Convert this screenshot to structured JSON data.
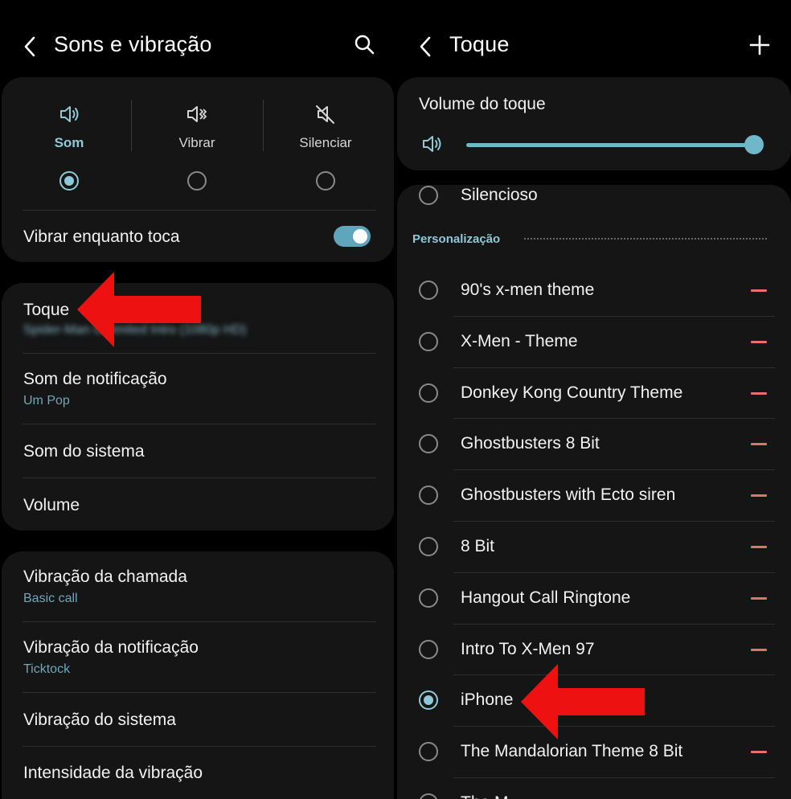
{
  "left": {
    "title": "Sons e vibração",
    "modes": [
      {
        "label": "Som",
        "icon": "speaker-icon",
        "selected": true
      },
      {
        "label": "Vibrar",
        "icon": "vibrate-icon",
        "selected": false
      },
      {
        "label": "Silenciar",
        "icon": "mute-icon",
        "selected": false
      }
    ],
    "vibrate_while_ringing": {
      "label": "Vibrar enquanto toca",
      "on": true
    },
    "settings": [
      {
        "label": "Toque",
        "value": "Spider-Man Unlimited Intro (1080p HD)"
      },
      {
        "label": "Som de notificação",
        "value": "Um Pop"
      },
      {
        "label": "Som do sistema"
      },
      {
        "label": "Volume"
      }
    ],
    "vibration_settings": [
      {
        "label": "Vibração da chamada",
        "value": "Basic call"
      },
      {
        "label": "Vibração da notificação",
        "value": "Ticktock"
      },
      {
        "label": "Vibração do sistema"
      },
      {
        "label": "Intensidade da vibração"
      }
    ]
  },
  "right": {
    "title": "Toque",
    "volume_label": "Volume do toque",
    "volume_level": 1.0,
    "silent_option": "Silencioso",
    "section_label": "Personalização",
    "ringtones": [
      {
        "name": "90's x-men theme",
        "selected": false,
        "removable": true
      },
      {
        "name": "X-Men - Theme",
        "selected": false,
        "removable": true
      },
      {
        "name": "Donkey Kong Country Theme",
        "selected": false,
        "removable": true
      },
      {
        "name": "Ghostbusters 8 Bit",
        "selected": false,
        "removable": true
      },
      {
        "name": "Ghostbusters with Ecto siren",
        "selected": false,
        "removable": true
      },
      {
        "name": "8 Bit",
        "selected": false,
        "removable": true
      },
      {
        "name": "Hangout Call Ringtone",
        "selected": false,
        "removable": true
      },
      {
        "name": "Intro To X-Men 97",
        "selected": false,
        "removable": true
      },
      {
        "name": "iPhone",
        "selected": true,
        "removable": false
      },
      {
        "name": "The Mandalorian Theme 8 Bit",
        "selected": false,
        "removable": true
      },
      {
        "name": "The M",
        "selected": false,
        "removable": false
      }
    ]
  },
  "colors": {
    "accent": "#8fc9d8",
    "subtext": "#6fa7b8",
    "remove": "#e0716b",
    "annotation_arrow": "#ee1111",
    "card": "#151515",
    "background": "#000000"
  }
}
